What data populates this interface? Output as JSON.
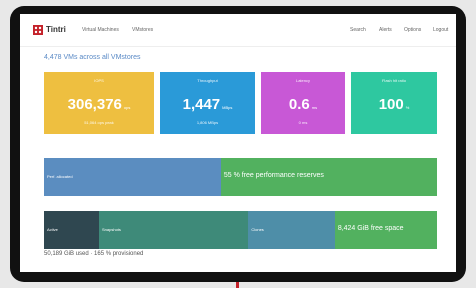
{
  "brand": {
    "name": "Tintri"
  },
  "nav": {
    "left": [
      "Virtual Machines",
      "VMstores"
    ],
    "right": [
      "Search",
      "Alerts",
      "Options",
      "Logout"
    ]
  },
  "heading": "4,478 VMs across all VMstores",
  "tiles": [
    {
      "label": "IOPS",
      "value": "306,376",
      "unit": "ops",
      "sub": "51,064 ops peak",
      "color": "#eebf40"
    },
    {
      "label": "Throughput",
      "value": "1,447",
      "unit": "MBps",
      "sub": "1,806 MBps",
      "color": "#2a9ad8"
    },
    {
      "label": "Latency",
      "value": "0.6",
      "unit": "ms",
      "sub": "0 ms",
      "color": "#c858d6"
    },
    {
      "label": "Flash hit ratio",
      "value": "100",
      "unit": "%",
      "sub": "",
      "color": "#2ec8a0"
    }
  ],
  "perf_bar": {
    "used_label": "Perf. allocated",
    "free_label": "55 % free performance reserves",
    "used_fraction": 0.45,
    "colors": {
      "used": "#5b8dc0",
      "free": "#52b15f"
    }
  },
  "capacity_bar": {
    "segments": [
      {
        "label": "Active",
        "fraction": 0.14,
        "color": "#2f4750"
      },
      {
        "label": "Snapshots",
        "fraction": 0.38,
        "color": "#3e8a79"
      },
      {
        "label": "Clones",
        "fraction": 0.22,
        "color": "#4e8ea8"
      }
    ],
    "free_label": "8,424 GiB free space",
    "free_color": "#52b15f"
  },
  "footer": "50,189 GiB used · 165 % provisioned"
}
